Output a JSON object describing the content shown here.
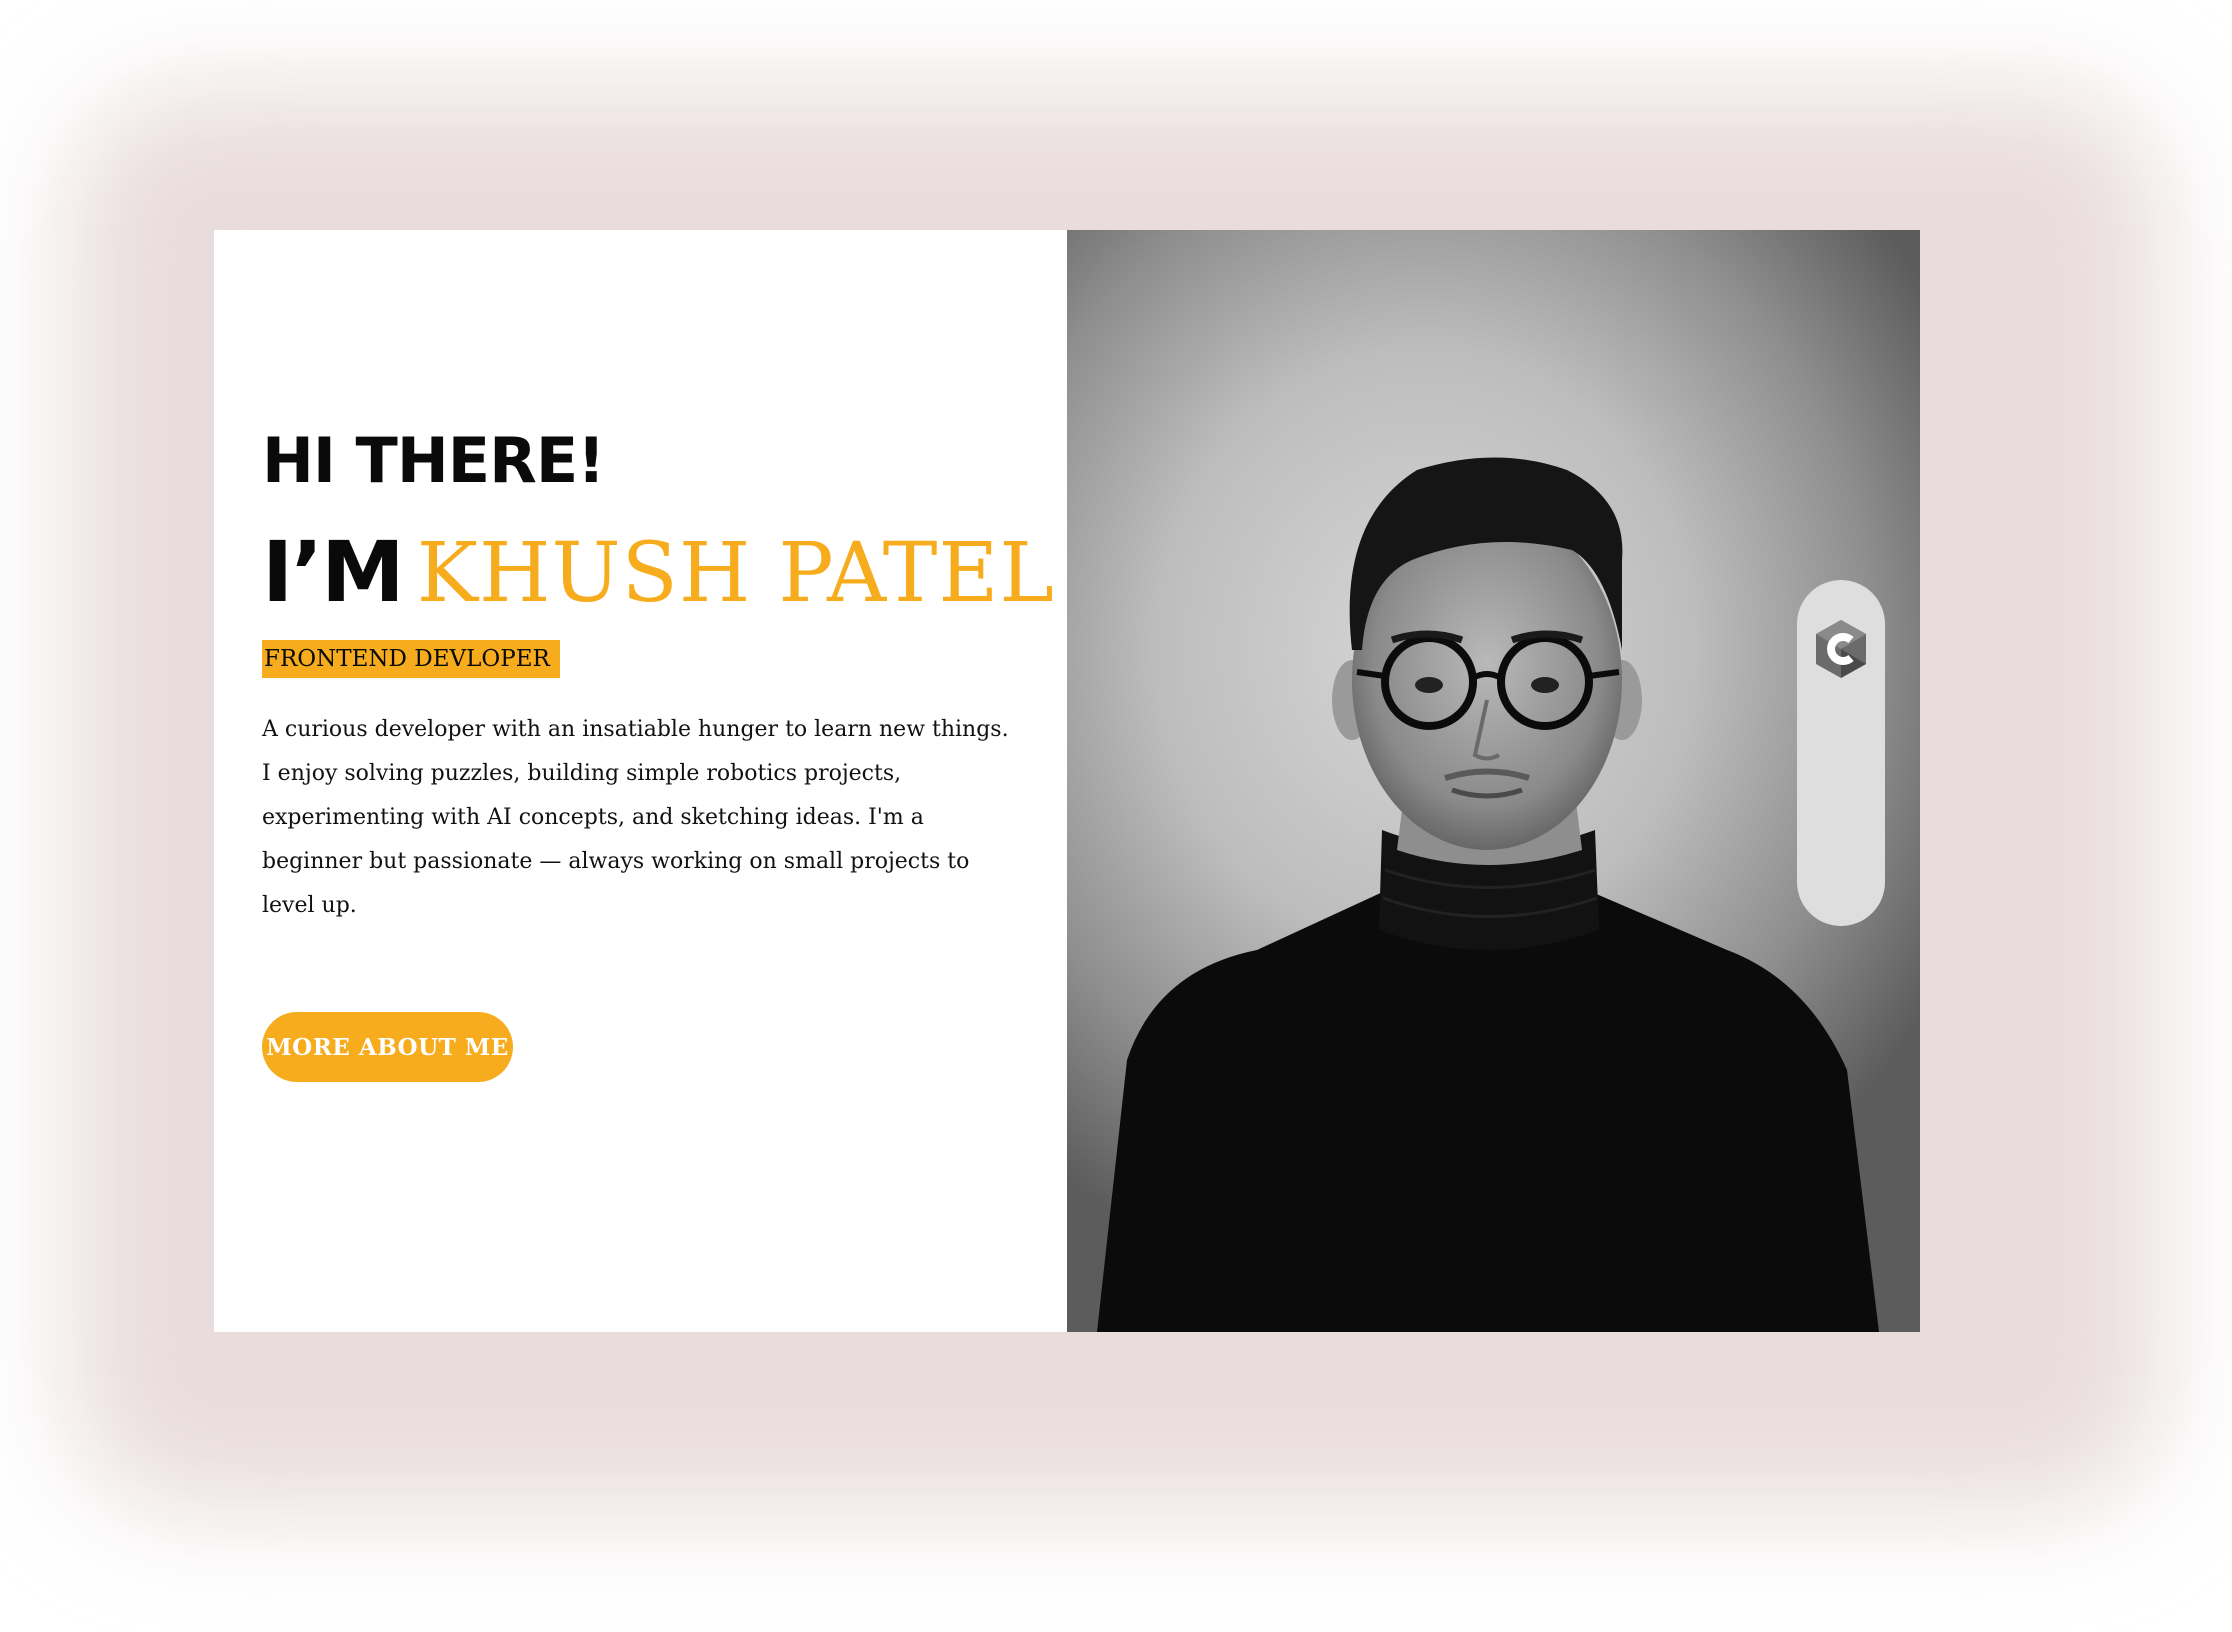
{
  "hero": {
    "greeting": "HI THERE!",
    "im_label": "I’M",
    "name": "KHUSH PATEL",
    "role": "FRONTEND DEVLOPER",
    "bio": "A curious developer with an insatiable hunger to learn new things. I enjoy solving puzzles, building simple robotics projects, experimenting with AI concepts, and sketching ideas. I'm a beginner but passionate — always working on small projects to level up.",
    "cta_label": "MORE ABOUT ME"
  },
  "portrait": {
    "description_icon": "portrait-photo"
  },
  "skills": {
    "icons": [
      "c-language-icon"
    ]
  },
  "colors": {
    "accent": "#f6ac1c",
    "backdrop": "#e9dcdc",
    "text": "#0a0a0a",
    "rail": "#dedede"
  }
}
